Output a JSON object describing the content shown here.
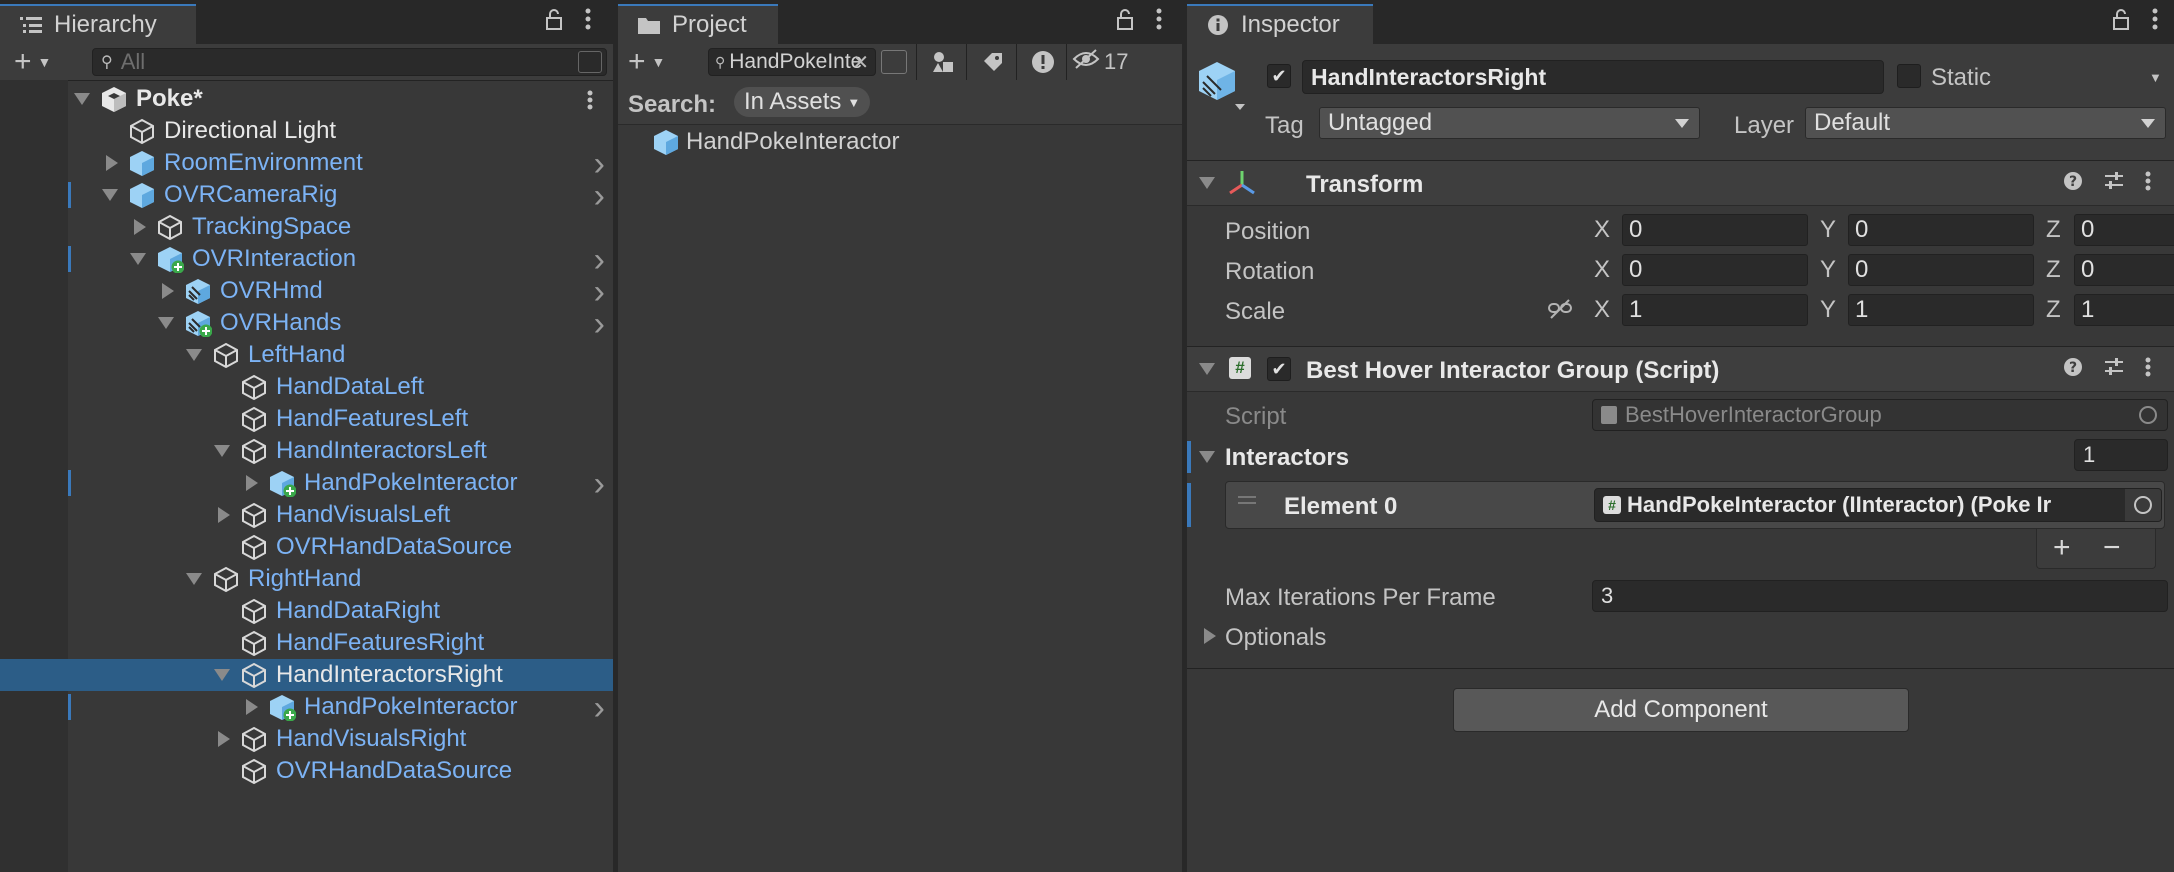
{
  "hierarchy": {
    "tab_label": "Hierarchy",
    "add_label": "+",
    "search_placeholder": "All",
    "rows": [
      {
        "label": "Poke*",
        "style": "scene"
      },
      {
        "label": "Directional Light",
        "style": "white"
      },
      {
        "label": "RoomEnvironment",
        "style": "blue"
      },
      {
        "label": "OVRCameraRig",
        "style": "blue"
      },
      {
        "label": "TrackingSpace",
        "style": "blue"
      },
      {
        "label": "OVRInteraction",
        "style": "blue"
      },
      {
        "label": "OVRHmd",
        "style": "blue"
      },
      {
        "label": "OVRHands",
        "style": "blue"
      },
      {
        "label": "LeftHand",
        "style": "blue"
      },
      {
        "label": "HandDataLeft",
        "style": "blue"
      },
      {
        "label": "HandFeaturesLeft",
        "style": "blue"
      },
      {
        "label": "HandInteractorsLeft",
        "style": "blue"
      },
      {
        "label": "HandPokeInteractor",
        "style": "blue"
      },
      {
        "label": "HandVisualsLeft",
        "style": "blue"
      },
      {
        "label": "OVRHandDataSource",
        "style": "blue"
      },
      {
        "label": "RightHand",
        "style": "blue"
      },
      {
        "label": "HandDataRight",
        "style": "blue"
      },
      {
        "label": "HandFeaturesRight",
        "style": "blue"
      },
      {
        "label": "HandInteractorsRight",
        "style": "selected"
      },
      {
        "label": "HandPokeInteractor",
        "style": "blue"
      },
      {
        "label": "HandVisualsRight",
        "style": "blue"
      },
      {
        "label": "OVRHandDataSource",
        "style": "blue"
      }
    ]
  },
  "project": {
    "tab_label": "Project",
    "add_label": "+",
    "search_value": "HandPokeInte",
    "hidden_count": "17",
    "search_label": "Search:",
    "search_scope": "In Assets",
    "results": [
      "HandPokeInteractor"
    ]
  },
  "inspector": {
    "tab_label": "Inspector",
    "object_name": "HandInteractorsRight",
    "static_label": "Static",
    "tag_label": "Tag",
    "tag_value": "Untagged",
    "layer_label": "Layer",
    "layer_value": "Default",
    "transform": {
      "title": "Transform",
      "rows": [
        {
          "label": "Position",
          "x": "0",
          "y": "0",
          "z": "0"
        },
        {
          "label": "Rotation",
          "x": "0",
          "y": "0",
          "z": "0"
        },
        {
          "label": "Scale",
          "x": "1",
          "y": "1",
          "z": "1"
        }
      ],
      "axis_x": "X",
      "axis_y": "Y",
      "axis_z": "Z"
    },
    "component": {
      "title": "Best Hover Interactor Group (Script)",
      "script_label": "Script",
      "script_value": "BestHoverInteractorGroup",
      "interactors_label": "Interactors",
      "interactors_count": "1",
      "element_label": "Element 0",
      "element_value": "HandPokeInteractor (IInteractor) (Poke Ir",
      "max_iter_label": "Max Iterations Per Frame",
      "max_iter_value": "3",
      "optionals_label": "Optionals",
      "plus": "+",
      "minus": "−"
    },
    "add_component_label": "Add Component"
  }
}
